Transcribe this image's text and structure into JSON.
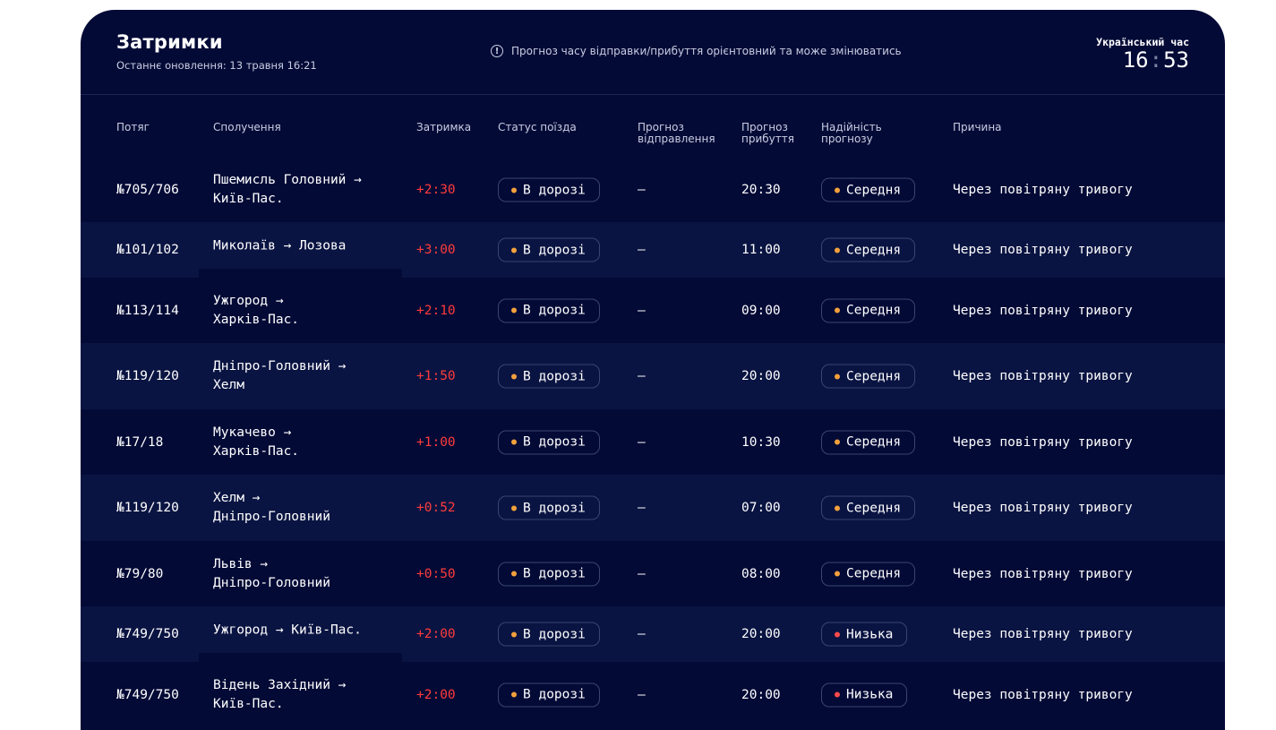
{
  "header": {
    "title": "Затримки",
    "last_updated": "Останнє оновлення: 13 травня 16:21",
    "notice": "Прогноз часу відправки/прибуття орієнтовний та може змінюватись",
    "notice_icon": "info-icon",
    "clock_label": "Український час",
    "clock_hours": "16",
    "clock_sep": ":",
    "clock_minutes": "53"
  },
  "columns": {
    "train": "Потяг",
    "route": "Сполучення",
    "delay": "Затримка",
    "status": "Статус поїзда",
    "departure": "Прогноз\nвідправлення",
    "arrival": "Прогноз\nприбуття",
    "reliability": "Надійність\nпрогнозу",
    "reason": "Причина"
  },
  "colors": {
    "background": "#030a36",
    "row_alt": "#0a1442",
    "delay": "#ff3b3b",
    "status_dot": "#f2a03c",
    "reliability_medium_dot": "#f2a03c",
    "reliability_low_dot": "#ff4a4a"
  },
  "rows": [
    {
      "train": "№705/706",
      "route": "Пшемисль Головний →\nКиїв-Пас.",
      "delay": "+2:30",
      "status": "В дорозі",
      "departure": "—",
      "arrival": "20:30",
      "reliability": "Середня",
      "reliability_level": "medium",
      "reason": "Через повітряну тривогу"
    },
    {
      "train": "№101/102",
      "route": "Миколаїв → Лозова",
      "delay": "+3:00",
      "status": "В дорозі",
      "departure": "—",
      "arrival": "11:00",
      "reliability": "Середня",
      "reliability_level": "medium",
      "reason": "Через повітряну тривогу"
    },
    {
      "train": "№113/114",
      "route": "Ужгород →\nХарків-Пас.",
      "delay": "+2:10",
      "status": "В дорозі",
      "departure": "—",
      "arrival": "09:00",
      "reliability": "Середня",
      "reliability_level": "medium",
      "reason": "Через повітряну тривогу"
    },
    {
      "train": "№119/120",
      "route": "Дніпро-Головний →\nХелм",
      "delay": "+1:50",
      "status": "В дорозі",
      "departure": "—",
      "arrival": "20:00",
      "reliability": "Середня",
      "reliability_level": "medium",
      "reason": "Через повітряну тривогу"
    },
    {
      "train": "№17/18",
      "route": "Мукачево →\nХарків-Пас.",
      "delay": "+1:00",
      "status": "В дорозі",
      "departure": "—",
      "arrival": "10:30",
      "reliability": "Середня",
      "reliability_level": "medium",
      "reason": "Через повітряну тривогу"
    },
    {
      "train": "№119/120",
      "route": "Хелм →\nДніпро-Головний",
      "delay": "+0:52",
      "status": "В дорозі",
      "departure": "—",
      "arrival": "07:00",
      "reliability": "Середня",
      "reliability_level": "medium",
      "reason": "Через повітряну тривогу"
    },
    {
      "train": "№79/80",
      "route": "Львів →\nДніпро-Головний",
      "delay": "+0:50",
      "status": "В дорозі",
      "departure": "—",
      "arrival": "08:00",
      "reliability": "Середня",
      "reliability_level": "medium",
      "reason": "Через повітряну тривогу"
    },
    {
      "train": "№749/750",
      "route": "Ужгород → Київ-Пас.",
      "delay": "+2:00",
      "status": "В дорозі",
      "departure": "—",
      "arrival": "20:00",
      "reliability": "Низька",
      "reliability_level": "low",
      "reason": "Через повітряну тривогу"
    },
    {
      "train": "№749/750",
      "route": "Відень Західний →\nКиїв-Пас.",
      "delay": "+2:00",
      "status": "В дорозі",
      "departure": "—",
      "arrival": "20:00",
      "reliability": "Низька",
      "reliability_level": "low",
      "reason": "Через повітряну тривогу"
    }
  ]
}
